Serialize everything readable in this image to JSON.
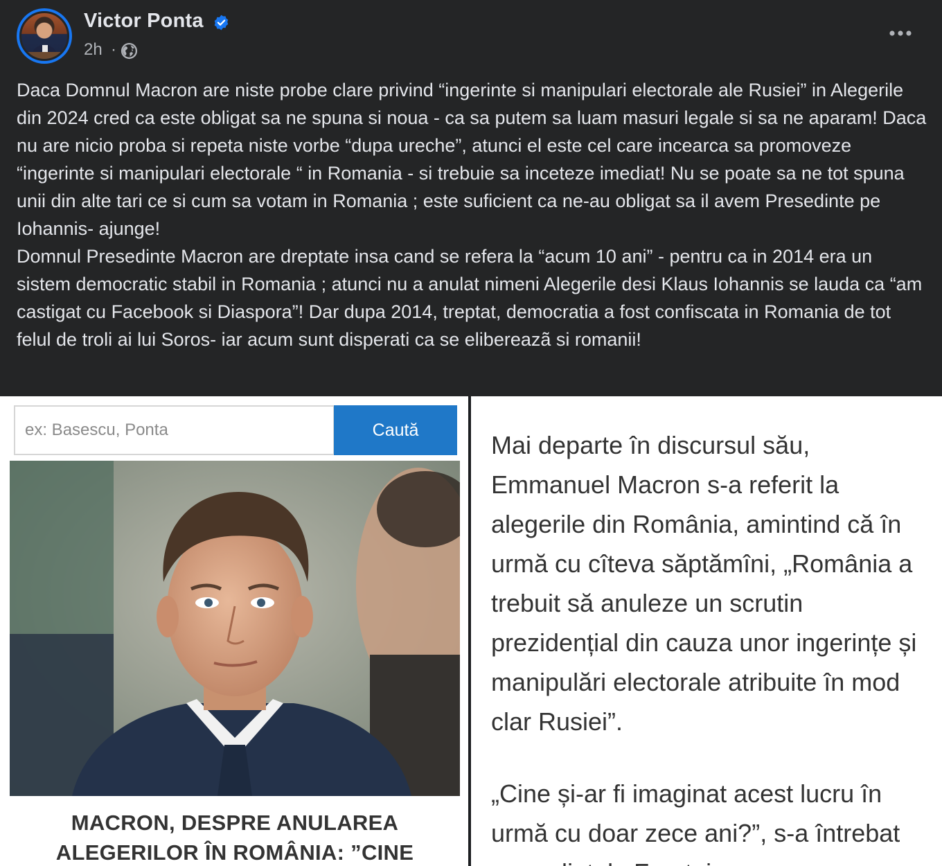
{
  "post": {
    "author": "Victor Ponta",
    "time": "2h",
    "separator": "·",
    "paragraphs": [
      "Daca Domnul Macron are niste probe clare privind “ingerinte si manipulari electorale ale Rusiei” in Alegerile din 2024 cred ca este obligat sa ne spuna si noua - ca sa putem sa luam masuri legale si sa ne aparam! Daca nu are nicio proba si repeta niste vorbe “dupa ureche”, atunci el este cel care incearca sa promoveze “ingerinte si manipulari electorale “ in Romania - si trebuie sa inceteze imediat! Nu se poate sa ne tot spuna unii din alte tari ce si cum sa votam in Romania ; este suficient ca ne-au obligat sa il avem Presedinte pe Iohannis- ajunge!",
      "Domnul Presedinte Macron are dreptate insa cand se refera la “acum 10 ani”  - pentru ca in 2014 era un sistem democratic stabil in Romania ; atunci nu a anulat nimeni Alegerile  desi Klaus Iohannis se lauda ca “am  castigat cu Facebook si Diaspora”! Dar dupa 2014, treptat, democratia a fost confiscata in Romania de tot felul de troli ai lui Soros- iar acum sunt disperati ca se elibereazã si romanii!"
    ]
  },
  "left_image": {
    "search_placeholder": "ex: Basescu, Ponta",
    "search_button": "Caută",
    "headline_line1": "MACRON, DESPRE ANULAREA",
    "headline_line2": "ALEGERILOR ÎN ROMÂNIA: ”CINE"
  },
  "right_image": {
    "paragraph1": "Mai departe în discursul său, Emmanuel Macron s-a referit la alegerile din România, amintind că în urmă cu cîteva săptămîni, „România a trebuit să anuleze un scrutin prezidențial din cauza unor ingerințe și manipulări electorale atribuite în mod clar Rusiei”.",
    "paragraph2": "„Cine și-ar fi imaginat acest lucru în urmă cu doar zece ani?”, s-a întrebat președintele Franței"
  },
  "icons": {
    "verified": "verified-badge-icon",
    "audience": "globe-icon",
    "more": "more-options-icon"
  },
  "colors": {
    "background": "#242526",
    "text": "#e4e6eb",
    "secondary_text": "#b0b3b8",
    "verified_blue": "#1877f2",
    "search_button": "#1f78c8"
  }
}
